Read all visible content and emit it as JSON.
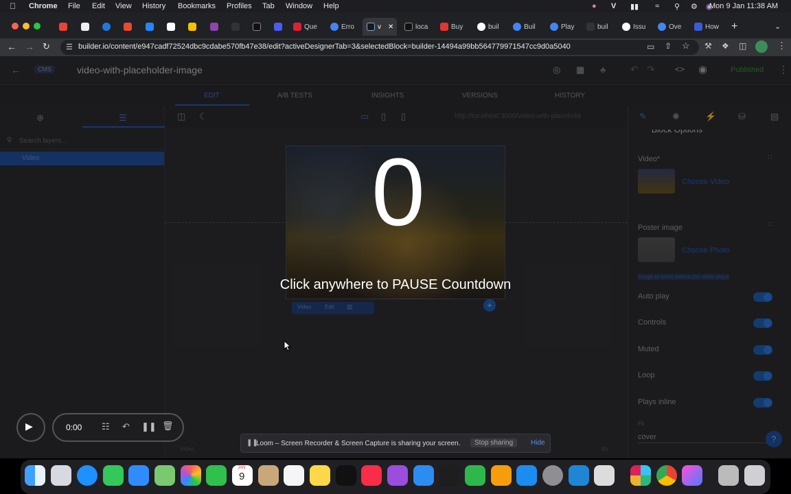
{
  "menubar": {
    "app": "Chrome",
    "items": [
      "File",
      "Edit",
      "View",
      "History",
      "Bookmarks",
      "Profiles",
      "Tab",
      "Window",
      "Help"
    ],
    "clock": "Mon 9 Jan  11:38 AM"
  },
  "tabs": [
    "",
    "",
    "",
    "",
    "",
    "",
    "",
    "",
    "",
    "Que",
    "Erro",
    "v",
    "loca",
    "Buy",
    "buil",
    "Buil",
    "Play",
    "buil",
    "Issu",
    "Ove",
    "How"
  ],
  "address": {
    "url": "builder.io/content/e947cadf72524dbc9cdabe570fb47e38/edit?activeDesignerTab=3&selectedBlock=builder-14494a99bb564779971547cc9d0a5040"
  },
  "editor": {
    "cms_label": "CMS",
    "title": "video-with-placeholder-image",
    "status": "Published",
    "tabs": [
      "EDIT",
      "A/B TESTS",
      "INSIGHTS",
      "VERSIONS",
      "HISTORY"
    ],
    "preview_url": "http://localhost:3000/video-with-placehold",
    "search_placeholder": "Search layers...",
    "layer_selected": "Video",
    "block_options_title": "Block Options",
    "block_toolbar_label": "Video",
    "block_toolbar_edit": "Edit",
    "bottom_left_label": "Video",
    "bottom_zoom": "80"
  },
  "options": {
    "video_label": "Video*",
    "choose_video": "Choose Video",
    "poster_label": "Poster image",
    "choose_photo": "Choose Photo",
    "poster_hint": "Image to show before the video plays",
    "toggles": [
      "Auto play",
      "Controls",
      "Muted",
      "Loop",
      "Plays inline"
    ],
    "fit_label": "Fit",
    "fit_value": "cover"
  },
  "countdown": {
    "number": "0",
    "message": "Click anywhere to PAUSE Countdown"
  },
  "recorder": {
    "time": "0:00"
  },
  "loom": {
    "message": "Loom – Screen Recorder & Screen Capture is sharing your screen.",
    "stop": "Stop sharing",
    "hide": "Hide"
  },
  "calendar": {
    "month": "JAN",
    "day": "9"
  },
  "colors": {
    "accent": "#1a73e8",
    "published": "#2e7d32",
    "selected_layer": "#1f4f9e"
  }
}
